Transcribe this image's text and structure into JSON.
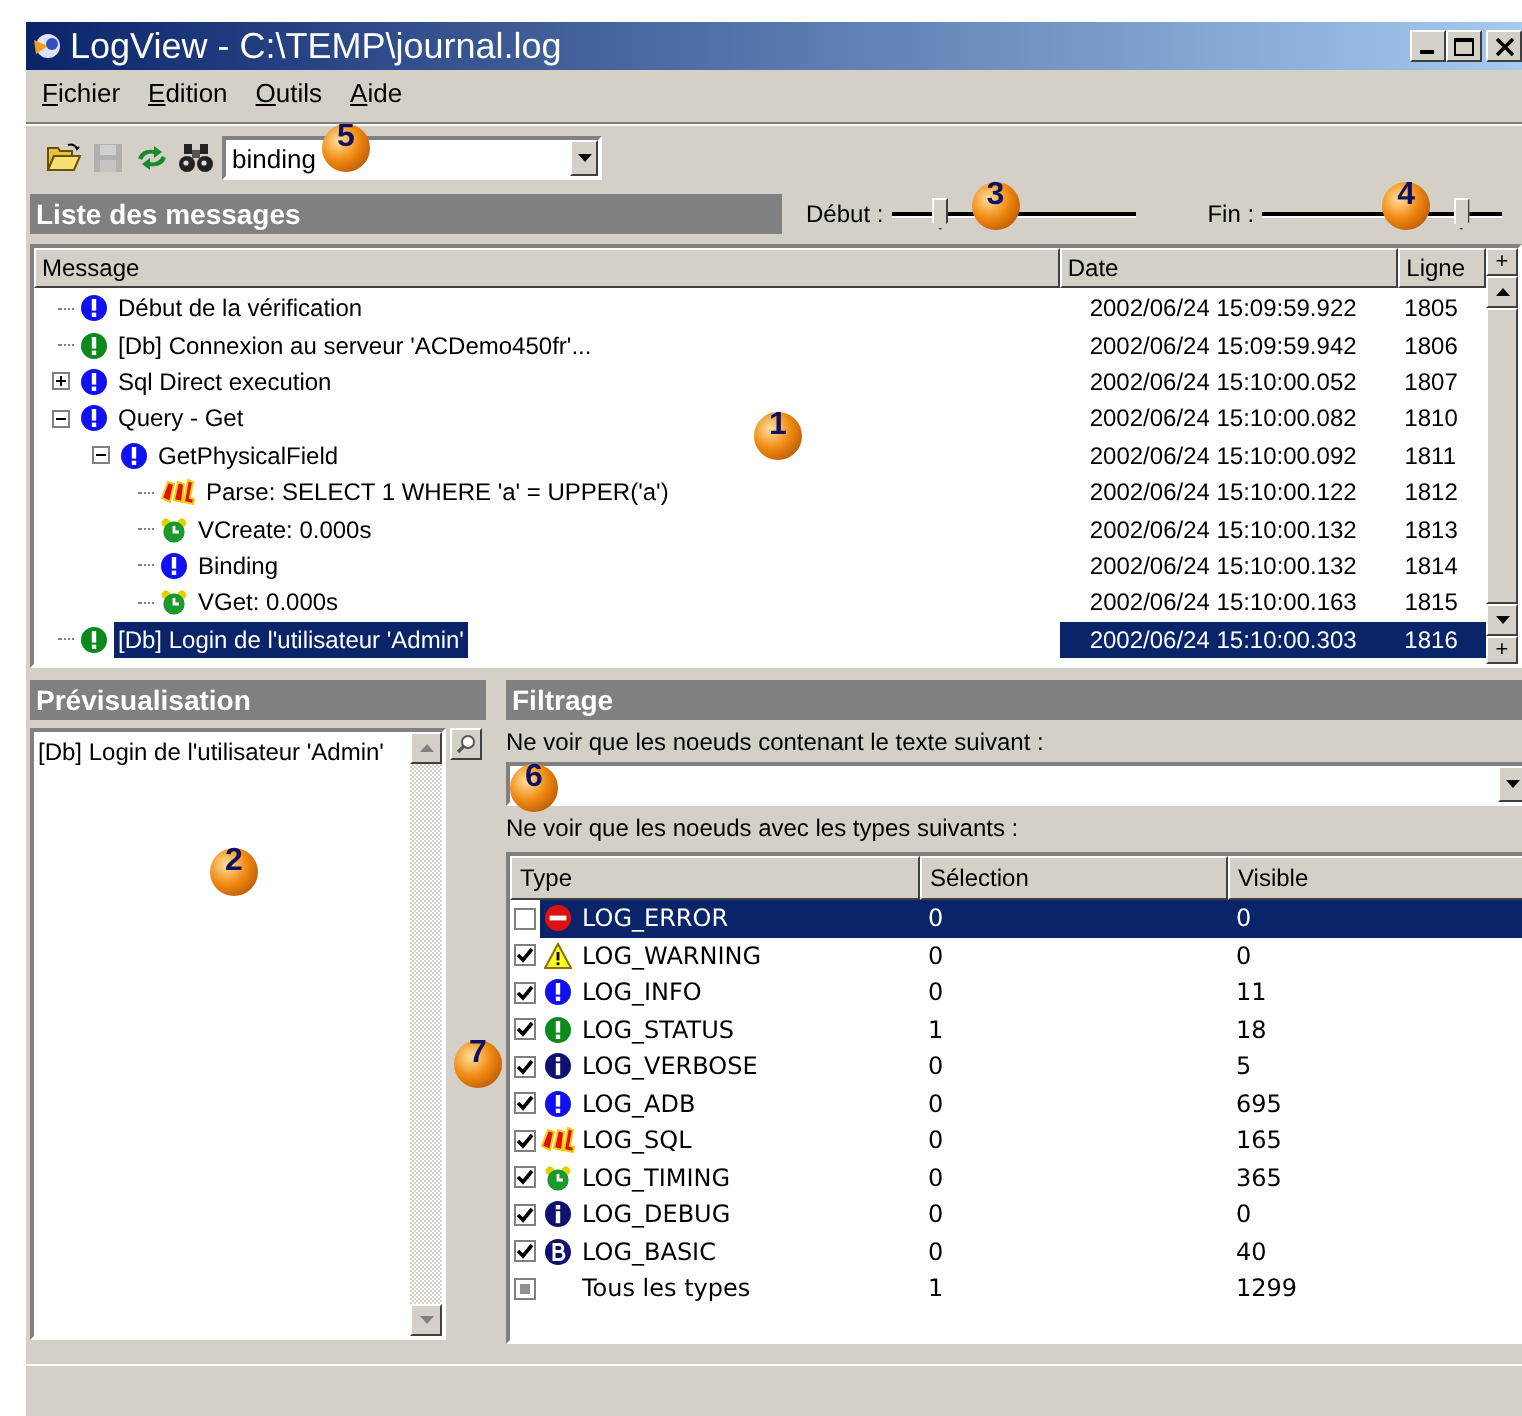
{
  "window": {
    "title": "LogView - C:\\TEMP\\journal.log"
  },
  "menu": [
    {
      "label": "Fichier"
    },
    {
      "label": "Edition"
    },
    {
      "label": "Outils"
    },
    {
      "label": "Aide"
    }
  ],
  "toolbar": {
    "buttons": [
      {
        "kind": "open",
        "disabled": false
      },
      {
        "kind": "save",
        "disabled": true
      },
      {
        "kind": "refresh",
        "disabled": false
      },
      {
        "kind": "find",
        "disabled": false
      }
    ],
    "search": {
      "value": "binding",
      "callout": "5"
    }
  },
  "messages": {
    "title": "Liste des messages",
    "start": {
      "label": "Début :",
      "level": 0.2,
      "callout": "3"
    },
    "end": {
      "label": "Fin :",
      "level": 0.83,
      "callout": "4"
    },
    "columns": [
      "Message",
      "Date",
      "Ligne"
    ],
    "corner_buttons": [
      "+",
      "+"
    ],
    "callout": "1",
    "rows": [
      {
        "kind": "info",
        "text": "Début de la vérification",
        "date": "2002/06/24 15:09:59.922",
        "line": "1805",
        "selected": false
      },
      {
        "kind": "status",
        "text": "[Db] Connexion au serveur 'ACDemo450fr'...",
        "date": "2002/06/24 15:09:59.942",
        "line": "1806",
        "selected": false
      },
      {
        "kind": "info",
        "text": "Sql Direct execution",
        "date": "2002/06/24 15:10:00.052",
        "line": "1807",
        "selected": false,
        "expanded": false
      },
      {
        "kind": "info",
        "text": "Query - Get",
        "date": "2002/06/24 15:10:00.082",
        "line": "1810",
        "selected": false,
        "expanded": true,
        "children": [
          {
            "kind": "info",
            "text": "GetPhysicalField",
            "date": "2002/06/24 15:10:00.092",
            "line": "1811",
            "selected": false,
            "expanded": true,
            "children": [
              {
                "kind": "sql",
                "text": "Parse: SELECT 1 WHERE 'a' = UPPER('a')",
                "date": "2002/06/24 15:10:00.122",
                "line": "1812",
                "selected": false
              },
              {
                "kind": "timing",
                "text": "VCreate: 0.000s",
                "date": "2002/06/24 15:10:00.132",
                "line": "1813",
                "selected": false
              },
              {
                "kind": "info",
                "text": "Binding",
                "date": "2002/06/24 15:10:00.132",
                "line": "1814",
                "selected": false
              },
              {
                "kind": "timing",
                "text": "VGet: 0.000s",
                "date": "2002/06/24 15:10:00.163",
                "line": "1815",
                "selected": false
              }
            ]
          }
        ]
      },
      {
        "kind": "status",
        "text": "[Db] Login de l'utilisateur 'Admin'",
        "date": "2002/06/24 15:10:00.303",
        "line": "1816",
        "selected": true
      }
    ]
  },
  "preview": {
    "title": "Prévisualisation",
    "text": "[Db] Login de l'utilisateur 'Admin'",
    "callout": "2"
  },
  "filter": {
    "title": "Filtrage",
    "text_label": "Ne voir que les noeuds contenant le texte suivant :",
    "text_callout": "6",
    "types_label": "Ne voir que les noeuds avec les types suivants :",
    "columns": [
      "Type",
      "Sélection",
      "Visible"
    ],
    "callout": "7",
    "rows": [
      {
        "checked": false,
        "mixed": false,
        "kind": "error",
        "type": "LOG_ERROR",
        "selection": "0",
        "visible": "0",
        "selected": true
      },
      {
        "checked": true,
        "mixed": false,
        "kind": "warning",
        "type": "LOG_WARNING",
        "selection": "0",
        "visible": "0",
        "selected": false
      },
      {
        "checked": true,
        "mixed": false,
        "kind": "info",
        "type": "LOG_INFO",
        "selection": "0",
        "visible": "11",
        "selected": false
      },
      {
        "checked": true,
        "mixed": false,
        "kind": "status",
        "type": "LOG_STATUS",
        "selection": "1",
        "visible": "18",
        "selected": false
      },
      {
        "checked": true,
        "mixed": false,
        "kind": "verbose",
        "type": "LOG_VERBOSE",
        "selection": "0",
        "visible": "5",
        "selected": false
      },
      {
        "checked": true,
        "mixed": false,
        "kind": "info",
        "type": "LOG_ADB",
        "selection": "0",
        "visible": "695",
        "selected": false
      },
      {
        "checked": true,
        "mixed": false,
        "kind": "sql",
        "type": "LOG_SQL",
        "selection": "0",
        "visible": "165",
        "selected": false
      },
      {
        "checked": true,
        "mixed": false,
        "kind": "timing",
        "type": "LOG_TIMING",
        "selection": "0",
        "visible": "365",
        "selected": false
      },
      {
        "checked": true,
        "mixed": false,
        "kind": "verbose",
        "type": "LOG_DEBUG",
        "selection": "0",
        "visible": "0",
        "selected": false
      },
      {
        "checked": true,
        "mixed": false,
        "kind": "basic",
        "type": "LOG_BASIC",
        "selection": "0",
        "visible": "40",
        "selected": false
      },
      {
        "checked": true,
        "mixed": true,
        "kind": "all",
        "type": "Tous les types",
        "selection": "1",
        "visible": "1299",
        "selected": false
      }
    ]
  }
}
